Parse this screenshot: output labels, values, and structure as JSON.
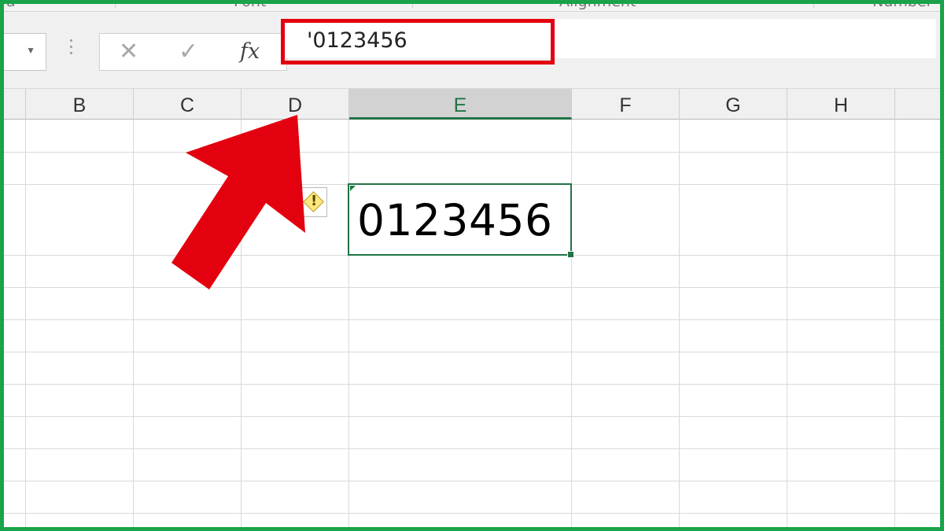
{
  "ribbon": {
    "groups": [
      "a",
      "Font",
      "Alignment",
      "Number"
    ]
  },
  "formula_bar": {
    "name_box_value": "",
    "cancel_icon": "✕",
    "enter_icon": "✓",
    "fx_label": "fx",
    "formula_value": "'0123456"
  },
  "columns": [
    "B",
    "C",
    "D",
    "E",
    "F",
    "G",
    "H"
  ],
  "active_column": "E",
  "active_cell": {
    "column": "E",
    "display_value": "0123456"
  },
  "error_indicator_icon": "warning-diamond-icon",
  "highlight_colors": {
    "formula_highlight": "#e3000f",
    "arrow": "#e3000f",
    "frame": "#1aa34a",
    "selection": "#217346"
  }
}
